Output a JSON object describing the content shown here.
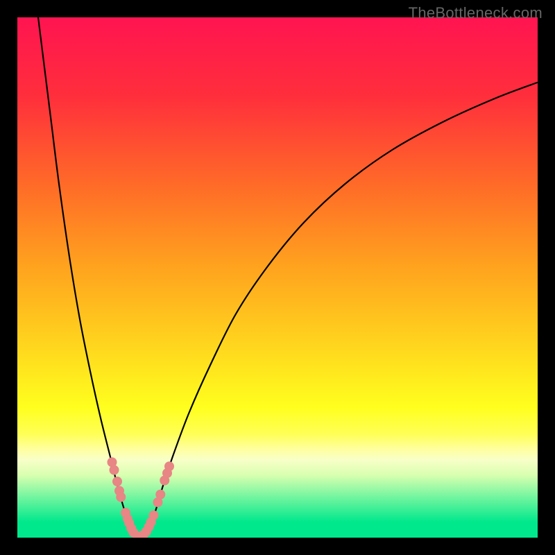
{
  "watermark": "TheBottleneck.com",
  "chart_data": {
    "type": "line",
    "title": "",
    "xlabel": "",
    "ylabel": "",
    "xlim": [
      0,
      100
    ],
    "ylim": [
      0,
      100
    ],
    "gradient_stops": [
      {
        "offset": 0,
        "color": "#ff1450"
      },
      {
        "offset": 15,
        "color": "#ff2e3c"
      },
      {
        "offset": 32,
        "color": "#ff6a28"
      },
      {
        "offset": 48,
        "color": "#ffa31e"
      },
      {
        "offset": 62,
        "color": "#ffd21e"
      },
      {
        "offset": 75,
        "color": "#ffff1e"
      },
      {
        "offset": 80,
        "color": "#ffff55"
      },
      {
        "offset": 83,
        "color": "#ffffa0"
      },
      {
        "offset": 85,
        "color": "#f8ffc8"
      },
      {
        "offset": 88,
        "color": "#d8ffb0"
      },
      {
        "offset": 92,
        "color": "#78f5a0"
      },
      {
        "offset": 97,
        "color": "#00e88c"
      },
      {
        "offset": 100,
        "color": "#00e88c"
      }
    ],
    "series": [
      {
        "name": "curve",
        "color": "#000000",
        "points": [
          {
            "x": 4.0,
            "y": 100.0
          },
          {
            "x": 5.0,
            "y": 92.0
          },
          {
            "x": 6.5,
            "y": 80.0
          },
          {
            "x": 8.0,
            "y": 68.0
          },
          {
            "x": 10.0,
            "y": 54.0
          },
          {
            "x": 12.0,
            "y": 42.0
          },
          {
            "x": 14.0,
            "y": 32.0
          },
          {
            "x": 16.0,
            "y": 23.0
          },
          {
            "x": 18.0,
            "y": 15.0
          },
          {
            "x": 19.5,
            "y": 9.0
          },
          {
            "x": 21.0,
            "y": 4.0
          },
          {
            "x": 22.0,
            "y": 1.5
          },
          {
            "x": 23.0,
            "y": 0.2
          },
          {
            "x": 24.0,
            "y": 0.2
          },
          {
            "x": 25.0,
            "y": 1.5
          },
          {
            "x": 26.5,
            "y": 5.0
          },
          {
            "x": 28.0,
            "y": 10.0
          },
          {
            "x": 30.0,
            "y": 16.0
          },
          {
            "x": 33.0,
            "y": 24.0
          },
          {
            "x": 37.0,
            "y": 33.0
          },
          {
            "x": 42.0,
            "y": 43.0
          },
          {
            "x": 48.0,
            "y": 52.0
          },
          {
            "x": 55.0,
            "y": 60.5
          },
          {
            "x": 63.0,
            "y": 68.0
          },
          {
            "x": 72.0,
            "y": 74.5
          },
          {
            "x": 82.0,
            "y": 80.0
          },
          {
            "x": 92.0,
            "y": 84.5
          },
          {
            "x": 100.0,
            "y": 87.5
          }
        ]
      }
    ],
    "scatter": {
      "name": "markers",
      "color": "#e88585",
      "points": [
        {
          "x": 18.2,
          "y": 14.5
        },
        {
          "x": 18.6,
          "y": 13.0
        },
        {
          "x": 19.2,
          "y": 10.8
        },
        {
          "x": 19.6,
          "y": 9.0
        },
        {
          "x": 19.9,
          "y": 7.8
        },
        {
          "x": 20.8,
          "y": 4.8
        },
        {
          "x": 21.2,
          "y": 3.6
        },
        {
          "x": 21.5,
          "y": 2.8
        },
        {
          "x": 21.9,
          "y": 1.8
        },
        {
          "x": 22.3,
          "y": 1.0
        },
        {
          "x": 23.1,
          "y": 0.3
        },
        {
          "x": 23.5,
          "y": 0.2
        },
        {
          "x": 24.2,
          "y": 0.5
        },
        {
          "x": 24.8,
          "y": 1.2
        },
        {
          "x": 25.3,
          "y": 2.1
        },
        {
          "x": 25.7,
          "y": 3.0
        },
        {
          "x": 26.2,
          "y": 4.3
        },
        {
          "x": 27.0,
          "y": 6.8
        },
        {
          "x": 27.5,
          "y": 8.3
        },
        {
          "x": 28.3,
          "y": 11.0
        },
        {
          "x": 28.8,
          "y": 12.4
        },
        {
          "x": 29.2,
          "y": 13.7
        }
      ]
    }
  }
}
